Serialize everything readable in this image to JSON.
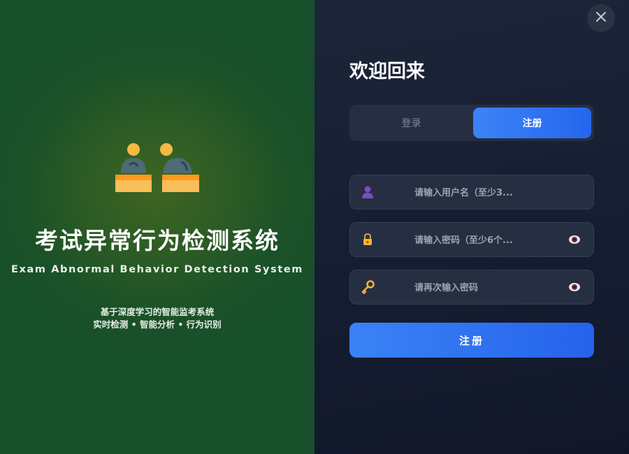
{
  "brand": {
    "title": "考试异常行为检测系统",
    "subtitle": "Exam Abnormal Behavior Detection System",
    "description_line1": "基于深度学习的智能监考系统",
    "description_line2": "实时检测 • 智能分析 • 行为识别",
    "illustration_icon": "exam-proctoring-icon"
  },
  "dialog": {
    "close_icon": "close-icon",
    "welcome": "欢迎回来",
    "tabs": [
      {
        "label": "登录",
        "active": false
      },
      {
        "label": "注册",
        "active": true
      }
    ],
    "fields": {
      "username": {
        "placeholder": "请输入用户名（至少3...",
        "value": "",
        "icon": "user-icon"
      },
      "password": {
        "placeholder": "请输入密码（至少6个...",
        "value": "",
        "icon": "lock-icon",
        "toggle_icon": "eye-icon"
      },
      "confirm_password": {
        "placeholder": "请再次输入密码",
        "value": "",
        "icon": "key-icon",
        "toggle_icon": "eye-icon"
      }
    },
    "submit_label": "注册"
  },
  "colors": {
    "accent": "#2f74f3",
    "left_panel": "#1d5a2a",
    "right_panel": "#161d31"
  }
}
